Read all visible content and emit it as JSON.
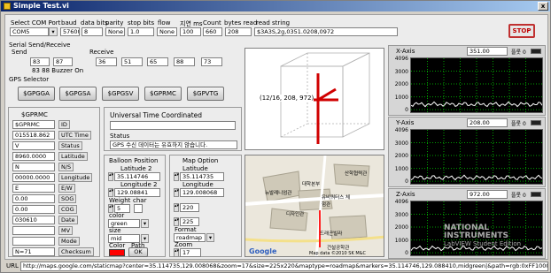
{
  "window": {
    "title": "Simple Test.vi",
    "close": "x"
  },
  "top": {
    "labels": [
      "Select COM Port",
      "baud",
      "data bits",
      "parity",
      "stop bits",
      "flow",
      "지연 ms",
      "Count",
      "bytes read",
      "read string"
    ],
    "com_port": "COM5",
    "baud": "57600",
    "data_bits": "8",
    "parity": "None",
    "stop_bits": "1.0",
    "flow": "None",
    "delay_ms": "100",
    "count": "660",
    "bytes_read": "208",
    "read_string": "$3A3S,2g,0351.0208,0972",
    "stop_label": "STOP"
  },
  "serial": {
    "title": "Serial Send/Receive",
    "send_label": "Send",
    "receive_label": "Receive",
    "send_values": [
      "83",
      "87"
    ],
    "receive_values": [
      "36",
      "51",
      "65",
      "88",
      "73"
    ],
    "send_caption": "83      88 Buzzer On"
  },
  "gps_selector": {
    "title": "GPS Selector",
    "buttons": [
      "$GPGGA",
      "$GPGSA",
      "$GPGSV",
      "$GPRMC",
      "$GPVTG"
    ]
  },
  "gprmc": {
    "title": "$GPRMC",
    "rows": [
      {
        "value": "$GPRMC",
        "tag": "ID"
      },
      {
        "value": "015518.862",
        "tag": "UTC Time"
      },
      {
        "value": "V",
        "tag": "Status"
      },
      {
        "value": "8960.0000",
        "tag": "Latitude"
      },
      {
        "value": "N",
        "tag": "N/S"
      },
      {
        "value": "00000.0000",
        "tag": "Longitude"
      },
      {
        "value": "E",
        "tag": "E/W"
      },
      {
        "value": "0.00",
        "tag": "SOG"
      },
      {
        "value": "0.00",
        "tag": "COG"
      },
      {
        "value": "030610",
        "tag": "Date"
      },
      {
        "value": "",
        "tag": "MV"
      },
      {
        "value": "",
        "tag": "Mode"
      },
      {
        "value": "N=71",
        "tag": "Checksum"
      }
    ]
  },
  "utc": {
    "title": "Universal Time Coordinated",
    "time_value": "",
    "status_label": "Status",
    "status_value": "GPS 수신 데이터는 유효하지 않습니다."
  },
  "balloon": {
    "title": "Balloon Position",
    "latitude_label": "Latitude 2",
    "latitude": "35.114746",
    "longitude_label": "Longitude 2",
    "longitude": "129.08841",
    "weight_label": "Weight",
    "weight": "5",
    "char_label": "char",
    "char": "",
    "color_label": "color",
    "color": "green",
    "size_label": "size",
    "size": "mid",
    "bcolor_label": "Color",
    "path_label": "Path",
    "ok_label": "OK",
    "swatch_color": "#ff0000"
  },
  "map_option": {
    "title": "Map Option",
    "latitude_label": "Latitude",
    "latitude": "35.114735",
    "longitude_label": "Longitude",
    "longitude": "129.008068",
    "v1": "220",
    "v2": "225",
    "format_label": "Format",
    "format": "roadmap",
    "zoom_label": "Zoom",
    "zoom": "17"
  },
  "cube": {
    "coord_label": "(12/16, 208, 972)"
  },
  "map": {
    "labels": [
      "산학협력관",
      "대학본부",
      "뉴발례니엄관",
      "유비쿼터스 체험관",
      "디자인관",
      "드래곤빌라",
      "건설공학관"
    ],
    "copyright": "Map data ©2010 SK M&C",
    "logo": "Google"
  },
  "charts": [
    {
      "axis": "X-Axis",
      "value": "351.00",
      "plot": "플롯 0",
      "ticks": [
        "4096",
        "3000",
        "2000",
        "1000",
        "0"
      ]
    },
    {
      "axis": "Y-Axis",
      "value": "208.00",
      "plot": "플롯 0",
      "ticks": [
        "4096",
        "3000",
        "2000",
        "1000",
        "0"
      ]
    },
    {
      "axis": "Z-Axis",
      "value": "972.00",
      "plot": "플롯 0",
      "ticks": [
        "4096",
        "3000",
        "2000",
        "1000",
        "0"
      ]
    }
  ],
  "chart_colors": {
    "grid": "#00a000",
    "trace": "#ffffff",
    "bg": "#000000"
  },
  "watermark": {
    "line1": "NATIONAL",
    "line2": "INSTRUMENTS",
    "line3": "LabVIEW Student Edition"
  },
  "url": {
    "label": "URL",
    "value": "http://maps.google.com/staticmap?center=35.114735,129.008068&zoom=17&size=225x220&maptype=roadmap&markers=35.114746,129.088410,midgreen|&path=rgb:0xFF1000,"
  }
}
